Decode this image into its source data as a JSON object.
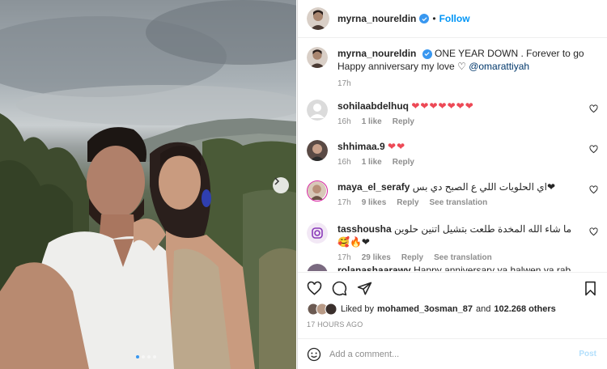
{
  "post": {
    "author": "myrna_noureldin",
    "follow_label": "Follow",
    "caption_title": "ONE YEAR DOWN . Forever to go",
    "caption_line2": "Happy anniversary my love",
    "mention": "@omarattiyah",
    "caption_time": "17h",
    "likes_prefix": "Liked by",
    "likes_user": "mohamed_3osman_87",
    "likes_and": "and",
    "likes_count": "102.268 others",
    "time_ago": "17 HOURS AGO",
    "add_comment_placeholder": "Add a comment...",
    "post_label": "Post",
    "carousel_position": 1,
    "carousel_total": 4
  },
  "comments": [
    {
      "user": "sohilaabdelhuq",
      "text": "❤❤❤❤❤❤❤",
      "time": "16h",
      "likes": "1 like",
      "reply": "Reply",
      "translation": ""
    },
    {
      "user": "shhimaa.9",
      "text": "❤❤",
      "time": "16h",
      "likes": "1 like",
      "reply": "Reply",
      "translation": ""
    },
    {
      "user": "maya_el_serafy",
      "text": "اي الحلويات اللي ع الصبح دي بس❤",
      "time": "17h",
      "likes": "9 likes",
      "reply": "Reply",
      "translation": "See translation"
    },
    {
      "user": "tasshousha",
      "text": "ما شاء الله المخدة طلعت بتشيل اتنين حلوين 🥰🔥❤",
      "time": "17h",
      "likes": "29 likes",
      "reply": "Reply",
      "translation": "See translation"
    },
    {
      "user": "rolanashaarawy",
      "text": "Happy anniversary ya halwen ya rab dyman",
      "time": "",
      "likes": "",
      "reply": "",
      "translation": ""
    }
  ],
  "colors": {
    "accent": "#0095f6",
    "verified": "#3897f0",
    "heart": "#ed4956",
    "muted": "#8e8e8e"
  },
  "icons": [
    "verified-badge-icon",
    "next-arrow-icon",
    "heart-icon",
    "comment-icon",
    "share-icon",
    "bookmark-icon",
    "emoji-icon"
  ]
}
